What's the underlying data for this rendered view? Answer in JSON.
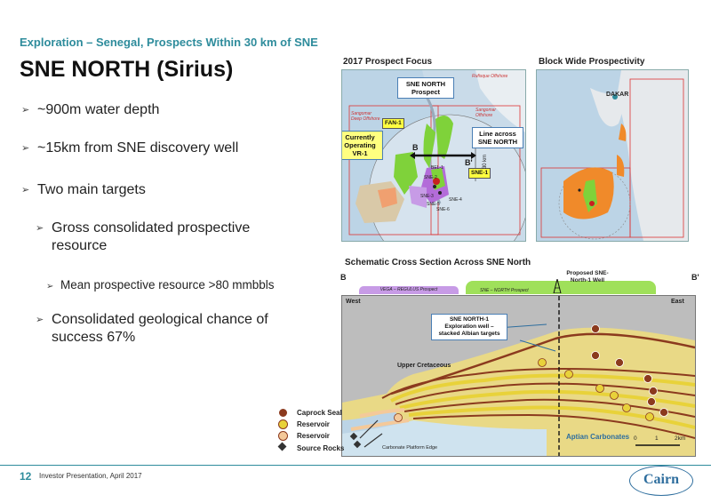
{
  "header": {
    "subtitle": "Exploration – Senegal, Prospects Within 30 km of SNE",
    "title": "SNE NORTH (Sirius)"
  },
  "bullets": [
    {
      "level": 1,
      "text": "~900m water depth"
    },
    {
      "level": 1,
      "text": "~15km from SNE discovery well"
    },
    {
      "level": 1,
      "text": "Two main targets"
    },
    {
      "level": 2,
      "text": "Gross consolidated prospective resource"
    },
    {
      "level": 3,
      "text": "Mean prospective resource >80 mmbbls"
    },
    {
      "level": 2,
      "text": "Consolidated geological chance of success 67%"
    }
  ],
  "prospect_map": {
    "title": "2017 Prospect Focus",
    "callouts": {
      "sne_north_prospect": "SNE NORTH Prospect",
      "currently_operating": "Currently Operating VR-1",
      "line_across": "Line across SNE NORTH"
    },
    "tags": {
      "fan1": "FAN-1",
      "sne1": "SNE-1"
    },
    "points": {
      "b": "B",
      "b_prime": "B'"
    },
    "wells": [
      "BEL-1",
      "SNE-2",
      "SNE-3",
      "SNE-4",
      "SNE-5",
      "SNE-6"
    ],
    "blocks": [
      "Rufisque Offshore",
      "Sangomar Deep Offshore",
      "Sangomar Offshore"
    ],
    "scale": "30 km"
  },
  "block_map": {
    "title": "Block Wide Prospectivity",
    "city": "DAKAR"
  },
  "cross_section": {
    "title": "Schematic Cross Section Across SNE North",
    "left_point": "B",
    "right_point": "B'",
    "west": "West",
    "east": "East",
    "prospects": [
      "VEGA – REGULUS Prospect",
      "SNE – NORTH Prospect"
    ],
    "proposed_well": "Proposed SNE-North-1 Well",
    "callout": "SNE NORTH-1 Exploration well – stacked Albian targets",
    "upper_cretaceous": "Upper Cretaceous",
    "aptian": "Aptian Carbonates",
    "platform_edge": "Carbonate Platform Edge",
    "scale": [
      "0",
      "1",
      "2km"
    ],
    "legend": [
      {
        "symbol": "C",
        "label": "Caprock Seal",
        "color": "#8b3a1e"
      },
      {
        "symbol": "R",
        "label": "Reservoir",
        "color": "#e8d23a"
      },
      {
        "symbol": "R",
        "label": "Reservoir",
        "color": "#f4c99a"
      },
      {
        "symbol": "S",
        "label": "Source Rocks",
        "color": "#333333"
      }
    ]
  },
  "footer": {
    "page": "12",
    "text": "Investor Presentation, April 2017",
    "logo": "Cairn"
  }
}
